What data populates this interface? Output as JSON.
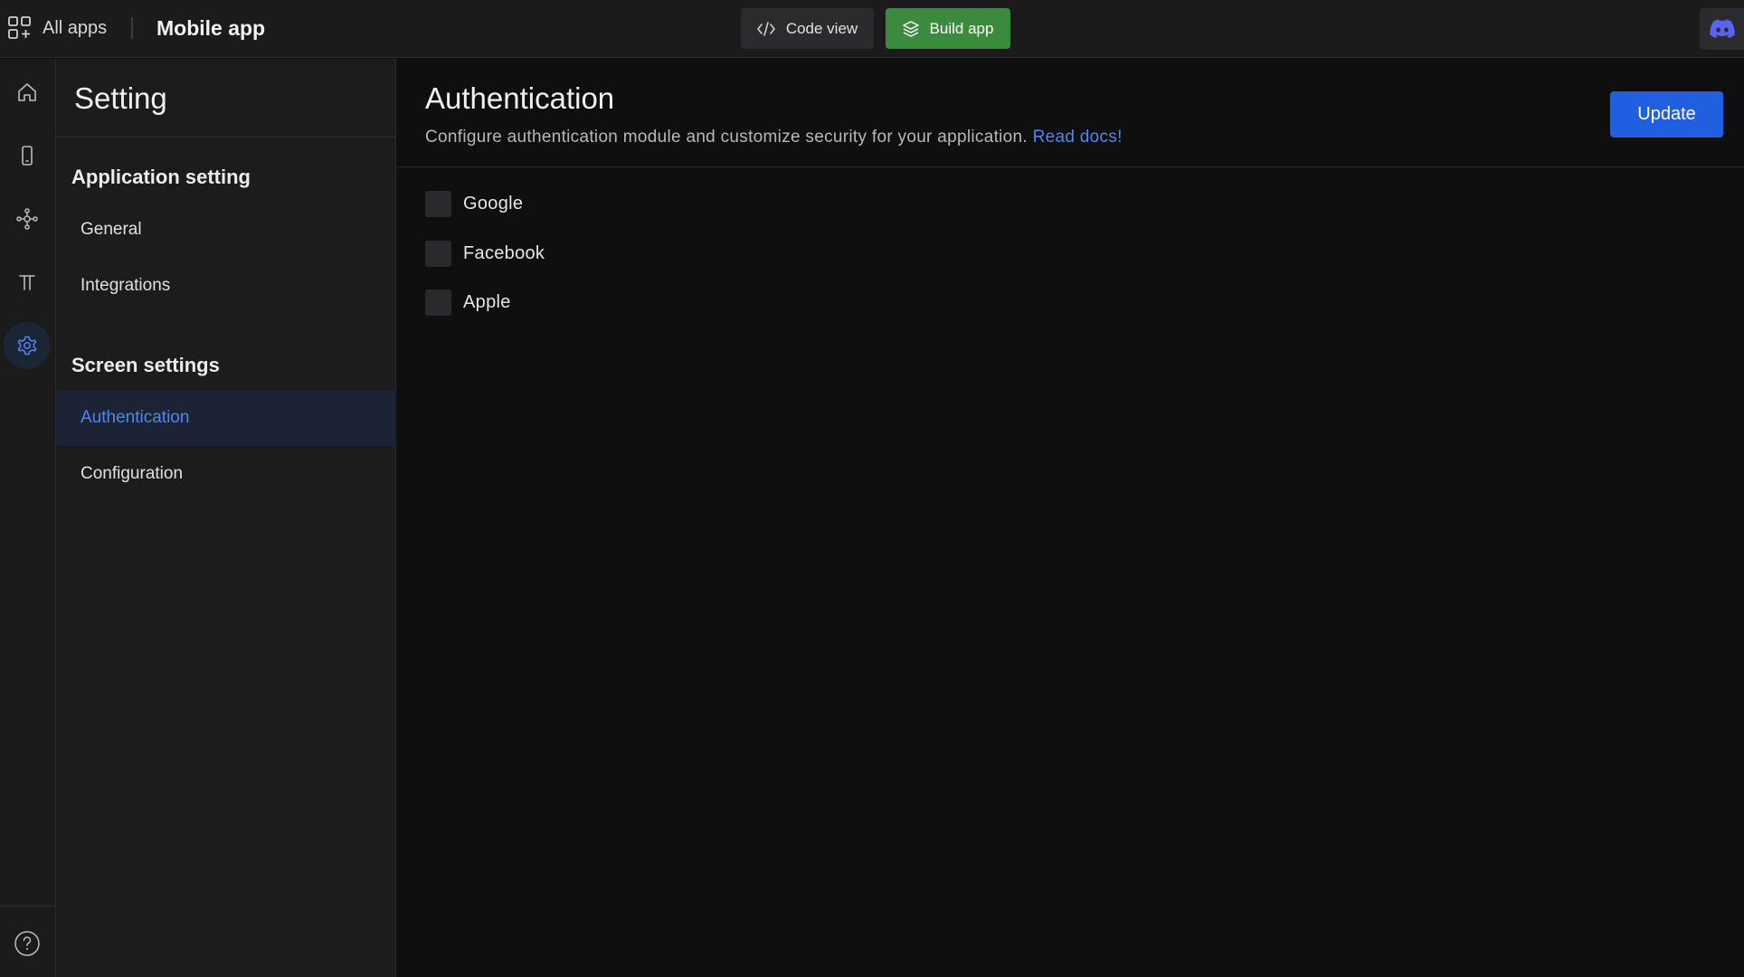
{
  "topbar": {
    "all_apps_label": "All apps",
    "app_title": "Mobile app",
    "code_view_label": "Code view",
    "build_app_label": "Build app"
  },
  "rail": {
    "items": [
      "home-icon",
      "mobile-icon",
      "nodes-icon",
      "typography-icon",
      "gear-icon"
    ],
    "active": "gear-icon",
    "bottom": "help-icon"
  },
  "settings_panel": {
    "title": "Setting",
    "sections": [
      {
        "heading": "Application setting",
        "items": [
          "General",
          "Integrations"
        ]
      },
      {
        "heading": "Screen settings",
        "items": [
          "Authentication",
          "Configuration"
        ]
      }
    ],
    "active_item": "Authentication"
  },
  "main": {
    "title": "Authentication",
    "description": "Configure authentication module and customize security for your application.",
    "docs_link": "Read docs!",
    "update_label": "Update",
    "options": [
      {
        "label": "Google",
        "checked": false
      },
      {
        "label": "Facebook",
        "checked": false
      },
      {
        "label": "Apple",
        "checked": false
      }
    ]
  },
  "colors": {
    "accent_blue": "#1f5fe0",
    "link_blue": "#4f86f0",
    "build_green": "#3c8a3e",
    "discord_purple": "#5865f2"
  }
}
